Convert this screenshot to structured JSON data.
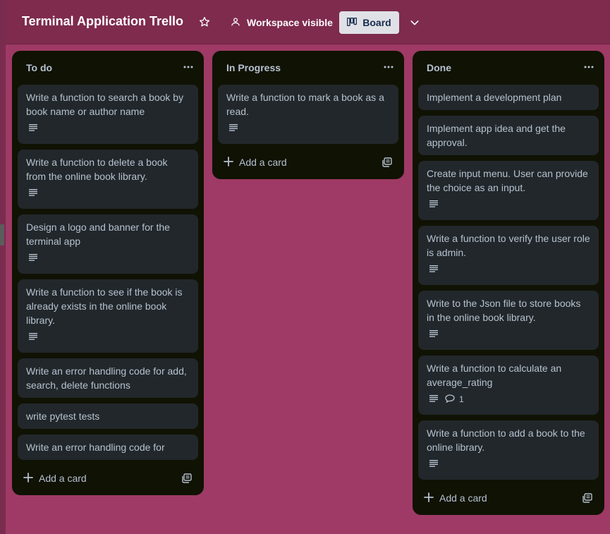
{
  "header": {
    "board_title": "Terminal Application Trello",
    "visibility_label": "Workspace visible",
    "view_label": "Board"
  },
  "lists": [
    {
      "title": "To do",
      "cards": [
        {
          "text": "Write a function to search a book by book name or author name",
          "has_description": true
        },
        {
          "text": "Write a function to delete a book from the online book library.",
          "has_description": true
        },
        {
          "text": "Design a logo and banner for the terminal app",
          "has_description": true
        },
        {
          "text": "Write a function to see if the book is already exists in the online book library.",
          "has_description": true
        },
        {
          "text": "Write an error handling code for add, search, delete functions",
          "has_description": false
        },
        {
          "text": "write pytest tests",
          "has_description": false
        },
        {
          "text": "Write an error handling code for",
          "has_description": false
        }
      ],
      "add_card_label": "Add a card"
    },
    {
      "title": "In Progress",
      "cards": [
        {
          "text": "Write a function to mark a book as a read.",
          "has_description": true
        }
      ],
      "add_card_label": "Add a card"
    },
    {
      "title": "Done",
      "cards": [
        {
          "text": "Implement a development plan",
          "has_description": false
        },
        {
          "text": "Implement app idea and get the approval.",
          "has_description": false
        },
        {
          "text": "Create input menu. User can provide the choice as an input.",
          "has_description": true
        },
        {
          "text": "Write a function to verify the user role is admin.",
          "has_description": true
        },
        {
          "text": "Write to the Json file to store books in the online book library.",
          "has_description": true
        },
        {
          "text": "Write a function to calculate an average_rating",
          "has_description": true,
          "comment_count": "1"
        },
        {
          "text": "Write a function to add a book to the online library.",
          "has_description": true
        }
      ],
      "add_card_label": "Add a card"
    }
  ],
  "icons": {
    "star": "star-icon",
    "visibility": "people-icon",
    "board": "board-icon",
    "chevron": "chevron-down-icon",
    "list_menu": "more-icon",
    "description": "description-icon",
    "comment": "comment-icon",
    "add": "plus-icon",
    "template": "template-icon"
  },
  "colors": {
    "board_bg": "#9e3a65",
    "header_bg": "#7e2b4e",
    "list_bg": "#101204",
    "card_bg": "#22272b",
    "text": "#b6c2cf"
  }
}
